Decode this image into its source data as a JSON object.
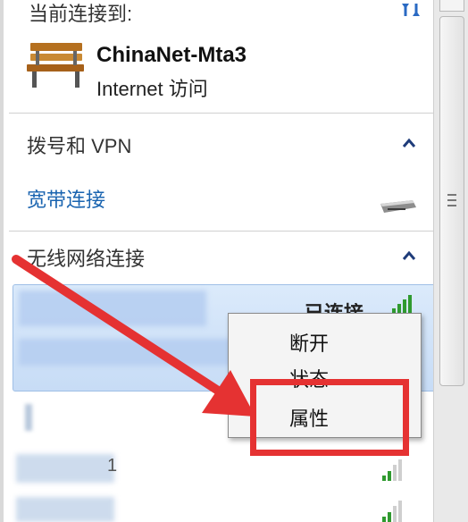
{
  "header": {
    "title": "当前连接到:"
  },
  "current_network": {
    "name": "ChinaNet-Mta3",
    "access": "Internet 访问"
  },
  "dialup": {
    "title": "拨号和 VPN",
    "item": "宽带连接"
  },
  "wireless": {
    "title": "无线网络连接",
    "status": "已连接"
  },
  "context_menu": {
    "disconnect": "断开",
    "status": "状态",
    "properties": "属性"
  },
  "partial_text": {
    "item_1": "1"
  },
  "colors": {
    "highlight_border": "#e53232",
    "arrow": "#e53232",
    "link_blue": "#1a64b0",
    "signal_green": "#2f9a2f"
  },
  "icons": {
    "refresh": "refresh-icon",
    "network": "bench-network-icon",
    "modem": "modem-icon",
    "signal": "wifi-signal-icon",
    "collapse": "chevron-up-icon"
  }
}
